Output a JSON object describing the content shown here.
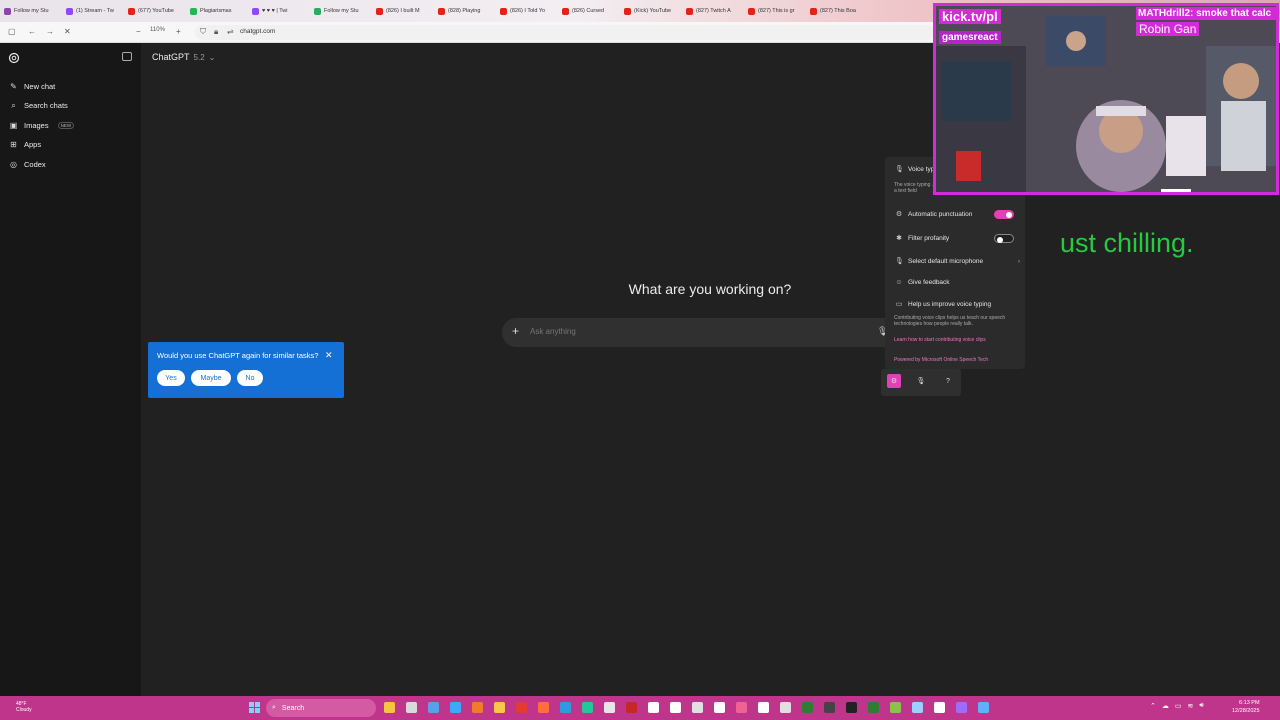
{
  "browser": {
    "tabs": [
      {
        "label": "Follow my Stu",
        "color": "#8e44ad"
      },
      {
        "label": "(1) Stream - Tw",
        "color": "#9146ff"
      },
      {
        "label": "(677) YouTube",
        "color": "#e62117"
      },
      {
        "label": "Plagiarismas",
        "color": "#1db954"
      },
      {
        "label": "♥ ♥ ♥ | Twi",
        "color": "#9146ff"
      },
      {
        "label": "Follow my Stu",
        "color": "#27ae60"
      },
      {
        "label": "(826) I built M",
        "color": "#e62117"
      },
      {
        "label": "(828) Playing",
        "color": "#e62117"
      },
      {
        "label": "(826) I Told Yo",
        "color": "#e62117"
      },
      {
        "label": "(826) Cursed",
        "color": "#e62117"
      },
      {
        "label": "(Kick) YouTube",
        "color": "#e62117"
      },
      {
        "label": "(827) Twitch A",
        "color": "#e62117"
      },
      {
        "label": "(827) This is gr",
        "color": "#e62117"
      },
      {
        "label": "(827) This Boa",
        "color": "#e62117"
      }
    ],
    "zoom": "110%",
    "url": "chatgpt.com"
  },
  "sidebar": {
    "items": [
      {
        "label": "New chat",
        "icon": "pencil-icon"
      },
      {
        "label": "Search chats",
        "icon": "search-icon"
      },
      {
        "label": "Images",
        "icon": "image-icon",
        "badge": "NEW"
      },
      {
        "label": "Apps",
        "icon": "apps-icon"
      },
      {
        "label": "Codex",
        "icon": "codex-icon"
      }
    ]
  },
  "main": {
    "model_name": "ChatGPT",
    "model_version": "5.2",
    "headline": "What are you working on?",
    "composer_placeholder": "Ask anything"
  },
  "survey": {
    "question": "Would you use ChatGPT again for similar tasks?",
    "options": [
      "Yes",
      "Maybe",
      "No"
    ]
  },
  "voice_panel": {
    "title": "Voice typing",
    "description": "The voice typing ... access voice typing when you're in a text field",
    "auto_punctuation": "Automatic punctuation",
    "auto_punctuation_on": true,
    "filter_profanity": "Filter profanity",
    "filter_profanity_on": false,
    "select_mic": "Select default microphone",
    "give_feedback": "Give feedback",
    "improve_title": "Help us improve voice typing",
    "improve_body": "Contributing voice clips helps us teach our speech technologies how people really talk.",
    "learn_link": "Learn how to start contributing voice clips",
    "powered_by": "Powered by Microsoft Online Speech Tech",
    "accent": "#e040b8"
  },
  "overlay": {
    "caption": "ust chilling.",
    "kick_label": "kick.tv/pl",
    "channel": "gamesreact",
    "chat_message": "MATHdrill2: smoke that calc",
    "chat_user": "Robin Gan"
  },
  "taskbar": {
    "weather_temp": "48°F",
    "weather_cond": "Cloudy",
    "search_label": "Search",
    "time": "6:13 PM",
    "date": "12/28/2025"
  }
}
